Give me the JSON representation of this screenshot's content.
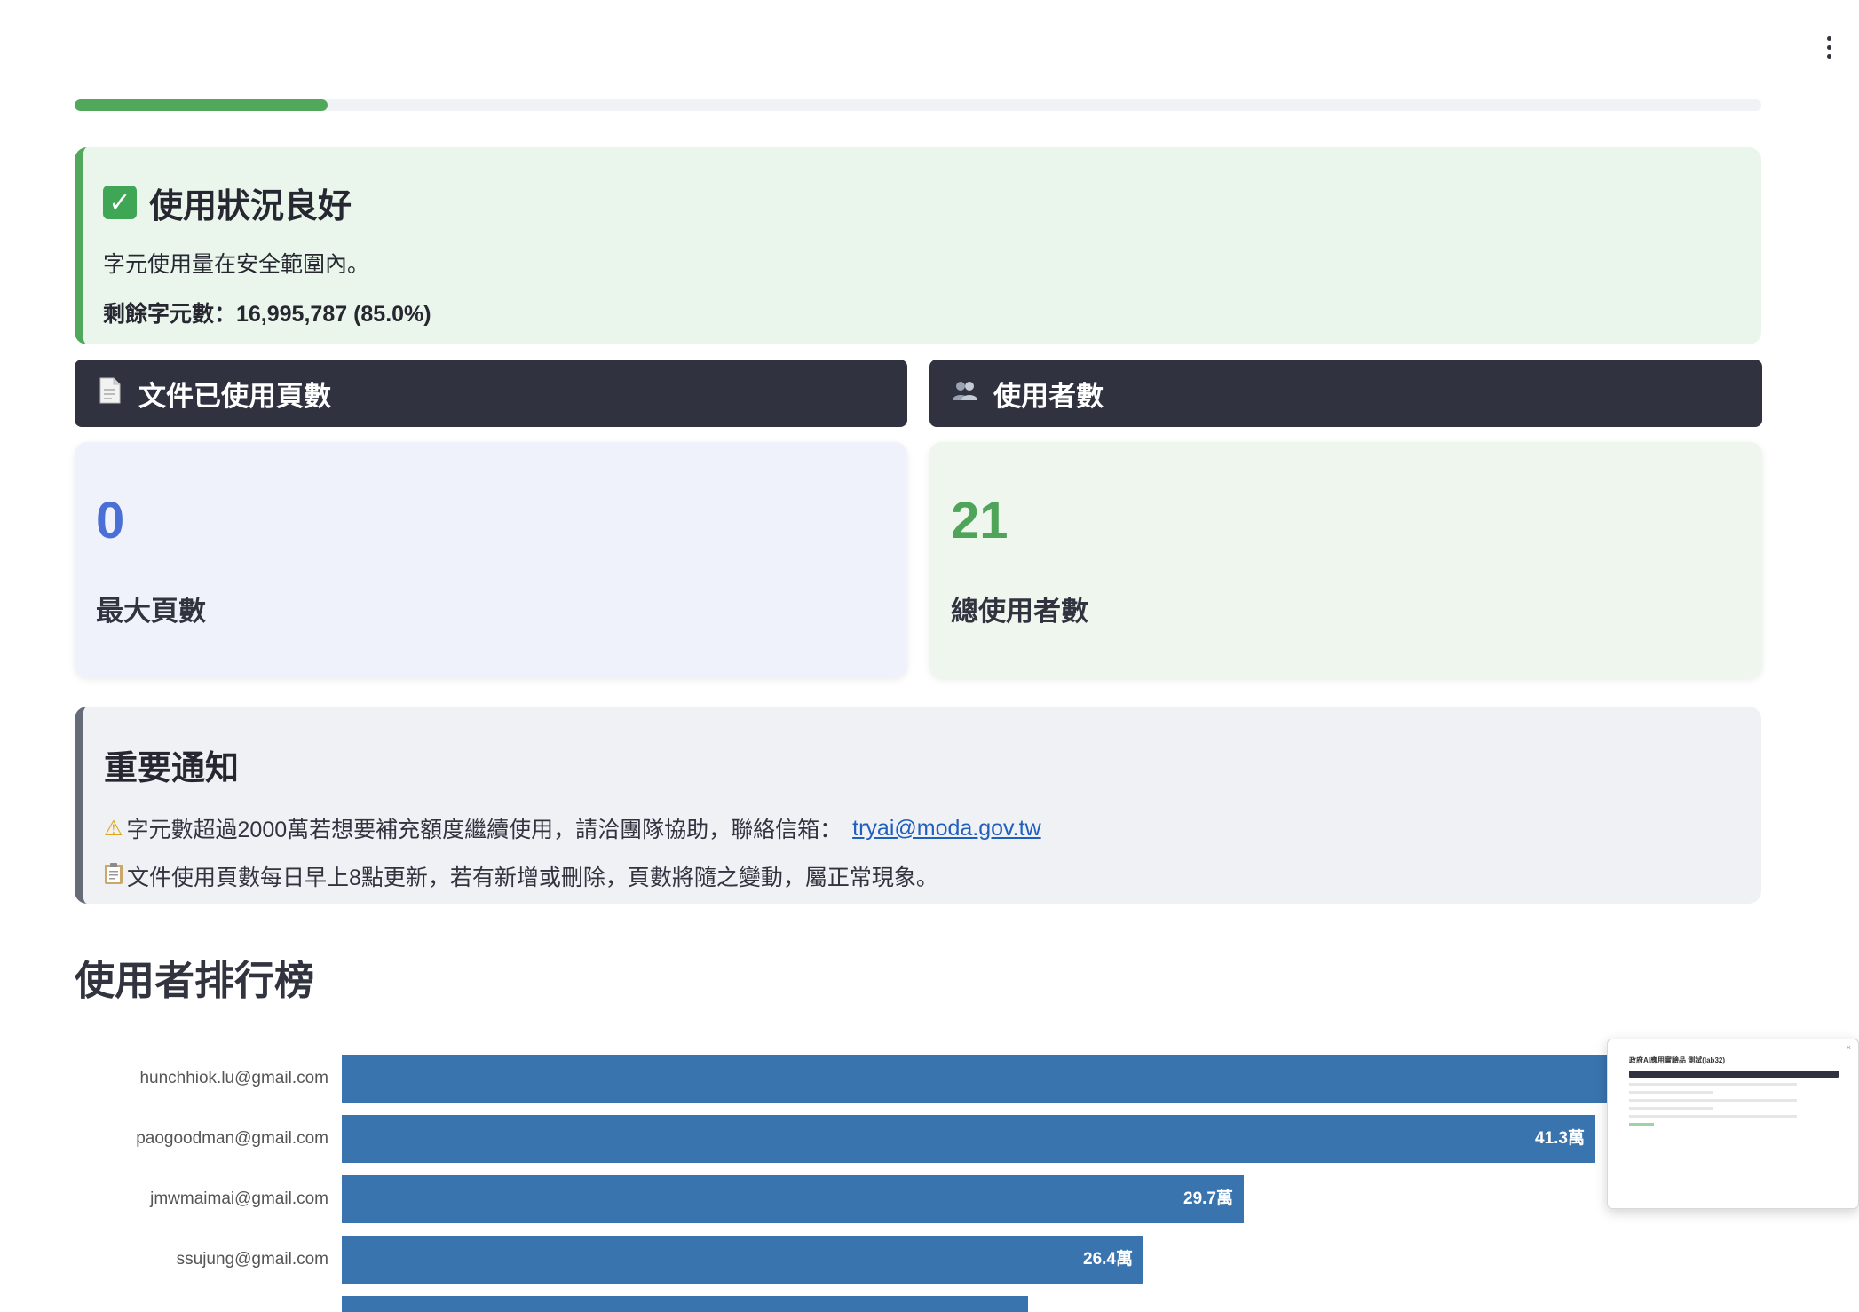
{
  "progress": {
    "fraction": 0.15
  },
  "status": {
    "title": "使用狀況良好",
    "message": "字元使用量在安全範圍內。",
    "remaining": "剩餘字元數：16,995,787 (85.0%)"
  },
  "cards": {
    "pages": {
      "header": "文件已使用頁數",
      "icon": "document-icon",
      "value": "0",
      "label": "最大頁數"
    },
    "users": {
      "header": "使用者數",
      "icon": "users-icon",
      "value": "21",
      "label": "總使用者數"
    }
  },
  "notice": {
    "title": "重要通知",
    "line1": "字元數超過2000萬若想要補充額度繼續使用，請洽團隊協助，聯絡信箱：",
    "email": "tryai@moda.gov.tw",
    "line2": "文件使用頁數每日早上8點更新，若有新增或刪除，頁數將隨之變動，屬正常現象。"
  },
  "ranking": {
    "title": "使用者排行榜"
  },
  "chart_data": {
    "type": "bar",
    "orientation": "horizontal",
    "categories": [
      "hunchhiok.lu@gmail.com",
      "paogoodman@gmail.com",
      "jmwmaimai@gmail.com",
      "ssujung@gmail.com",
      ""
    ],
    "values": [
      50.0,
      41.3,
      29.7,
      26.4,
      22.6
    ],
    "value_labels": [
      "",
      "41.3萬",
      "29.7萬",
      "26.4萬",
      ""
    ],
    "xlim": [
      0,
      50.0
    ],
    "color": "#3a74af"
  },
  "thumbnail": {
    "title": "政府AI應用實驗品 測試(lab32)"
  },
  "colors": {
    "accent_green": "#52a85a",
    "dark_header": "#30323f",
    "blue_number": "#4a6fd6",
    "green_number": "#4ea458",
    "bar": "#3a74af"
  }
}
